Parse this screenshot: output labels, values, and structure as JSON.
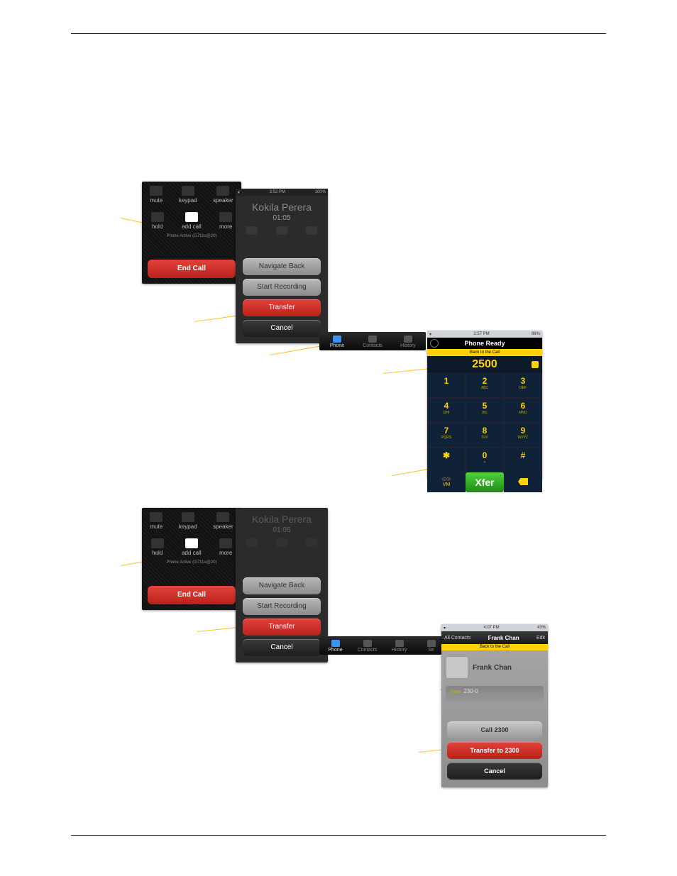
{
  "incall": {
    "mute": "mute",
    "keypad": "keypad",
    "speaker": "speaker",
    "hold": "hold",
    "addcall": "add call",
    "more": "more",
    "status": "Phone Active (G711u@20)",
    "endcall": "End Call"
  },
  "sheet": {
    "name": "Kokila Perera",
    "duration": "01:05",
    "statusbar_time": "3:52 PM",
    "battery": "100%",
    "nav_back": "Navigate Back",
    "start_rec": "Start Recording",
    "transfer": "Transfer",
    "cancel": "Cancel"
  },
  "tabs": {
    "phone": "Phone",
    "contacts": "Contacts",
    "history": "History",
    "settings": "Se"
  },
  "dialer": {
    "statusbar_time": "2:57 PM",
    "battery": "86%",
    "ready": "Phone Ready",
    "back": "Back to the Call",
    "display": "2500",
    "keys": [
      {
        "n": "1",
        "s": ""
      },
      {
        "n": "2",
        "s": "ABC"
      },
      {
        "n": "3",
        "s": "DEF"
      },
      {
        "n": "4",
        "s": "GHI"
      },
      {
        "n": "5",
        "s": "JKL"
      },
      {
        "n": "6",
        "s": "MNO"
      },
      {
        "n": "7",
        "s": "PQRS"
      },
      {
        "n": "8",
        "s": "TUV"
      },
      {
        "n": "9",
        "s": "WXYZ"
      },
      {
        "n": "✱",
        "s": ""
      },
      {
        "n": "0",
        "s": "+"
      },
      {
        "n": "#",
        "s": ""
      }
    ],
    "vm": "VM",
    "xfer": "Xfer"
  },
  "contact": {
    "statusbar_time": "4:07 PM",
    "battery": "43%",
    "all_contacts": "All Contacts",
    "title": "Frank Chan",
    "edit": "Edit",
    "back": "Back to the Call",
    "name": "Frank Chan",
    "field_label": "main",
    "field_value": "230-0",
    "call": "Call 2300",
    "transfer": "Transfer to 2300",
    "cancel": "Cancel"
  }
}
